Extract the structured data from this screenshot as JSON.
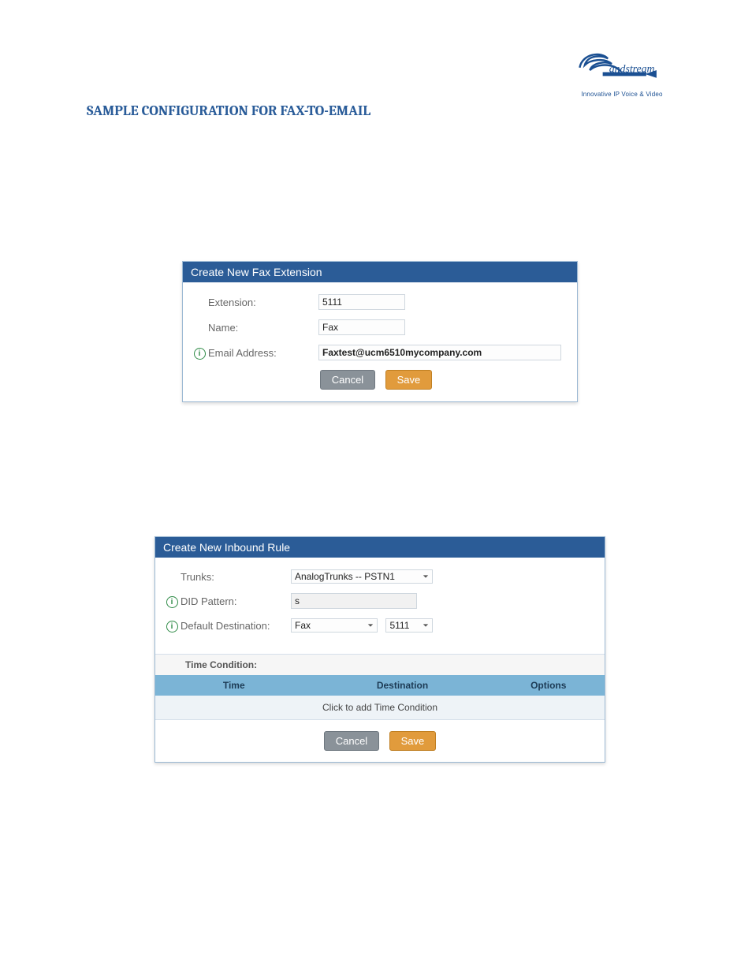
{
  "logo": {
    "word": "andstream",
    "tagline": "Innovative IP Voice & Video"
  },
  "heading": "SAMPLE CONFIGURATION FOR FAX-TO-EMAIL",
  "panel1": {
    "title": "Create New Fax Extension",
    "fields": {
      "extension_label": "Extension:",
      "extension_value": "5111",
      "name_label": "Name:",
      "name_value": "Fax",
      "email_label": "Email Address:",
      "email_value": "Faxtest@ucm6510mycompany.com"
    },
    "cancel_label": "Cancel",
    "save_label": "Save"
  },
  "panel2": {
    "title": "Create New Inbound Rule",
    "fields": {
      "trunks_label": "Trunks:",
      "trunks_value": "AnalogTrunks -- PSTN1",
      "did_label": "DID Pattern:",
      "did_value": "s",
      "dest_label": "Default Destination:",
      "dest_type": "Fax",
      "dest_ext": "5111"
    },
    "time_condition_label": "Time Condition:",
    "headers": {
      "time": "Time",
      "destination": "Destination",
      "options": "Options"
    },
    "add_time_text": "Click to add Time Condition",
    "cancel_label": "Cancel",
    "save_label": "Save"
  }
}
